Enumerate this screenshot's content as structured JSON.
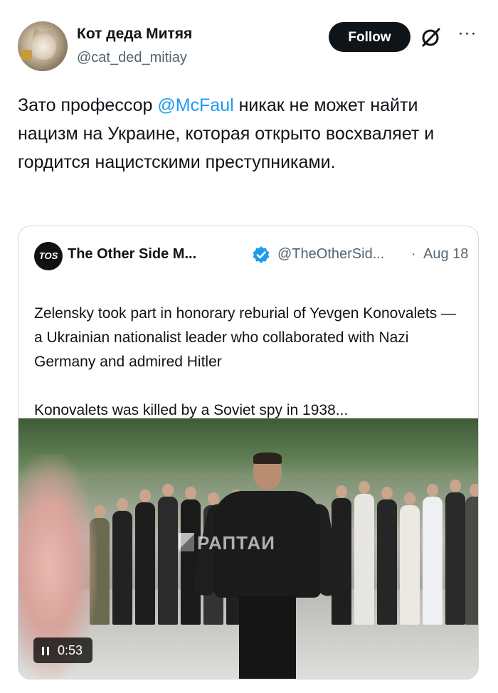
{
  "tweet": {
    "author": {
      "display_name": "Кот деда Митяя",
      "handle": "@cat_ded_mitiay",
      "avatar_icon": "cat-avatar"
    },
    "follow_label": "Follow",
    "grok_icon": "grok-icon",
    "more_icon": "more-icon",
    "more_glyph": "···",
    "text_before": "Зато профессор ",
    "mention": "@McFaul",
    "text_after": " никак не может найти нацизм на Украине, которая открыто восхваляет и гордится нацистскими преступниками."
  },
  "quoted_tweet": {
    "logo_text": "TOS",
    "author_name": "The Other Side M...",
    "verified_icon": "verified-badge-icon",
    "handle": "@TheOtherSid...",
    "separator": "·",
    "date": "Aug 18",
    "flag_icon": "ukraine-flag-icon",
    "paragraph_1": "Zelensky took part in honorary reburial of Yevgen Konovalets — a Ukrainian nationalist leader who collaborated with Nazi Germany and admired Hitler",
    "paragraph_2": "Konovalets was killed by a Soviet spy in 1938...",
    "video": {
      "watermark": "РАПТАИ",
      "duration": "0:53",
      "control_icon": "pause-icon"
    }
  },
  "colors": {
    "accent": "#1d9bf0",
    "text": "#0f1419",
    "secondary": "#536471",
    "follow_bg": "#0f1419",
    "border": "#cfd9de"
  }
}
